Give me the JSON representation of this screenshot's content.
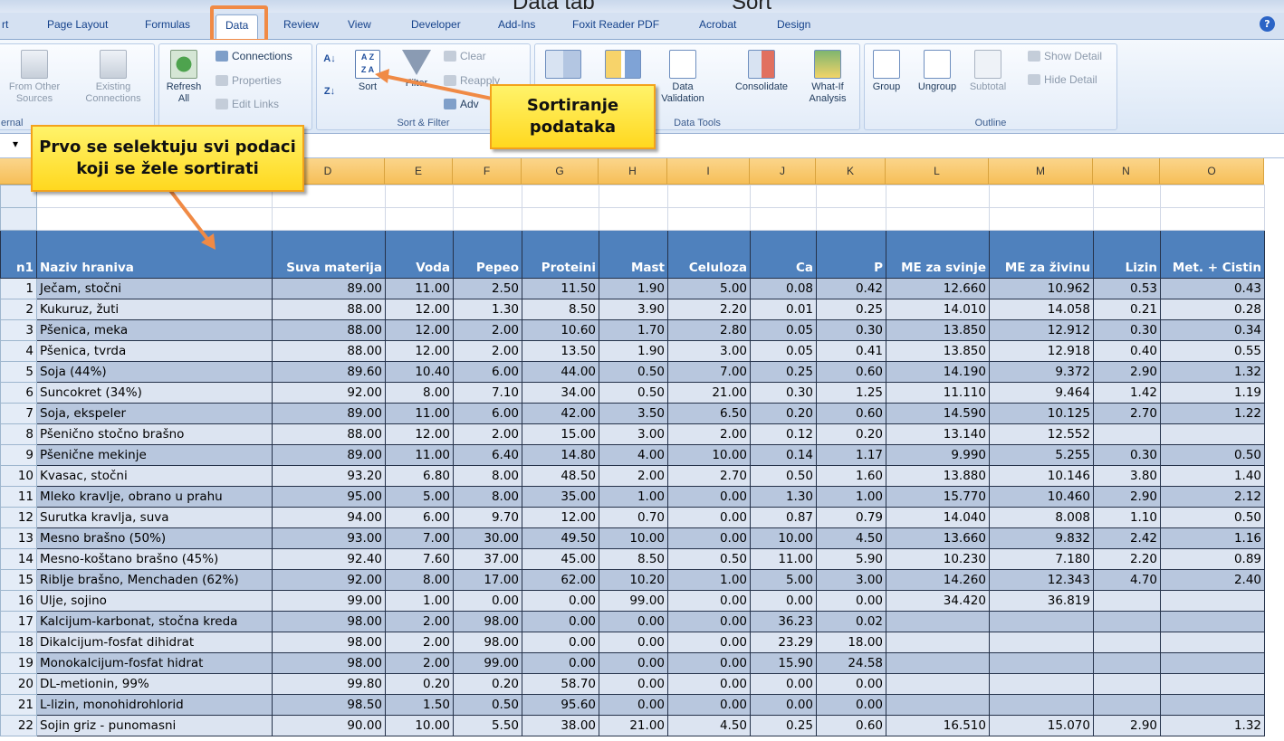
{
  "title_fragments": [
    "Data tab",
    "Sort"
  ],
  "tabs": [
    "rt",
    "Page Layout",
    "Formulas",
    "Data",
    "Review",
    "View",
    "Developer",
    "Add-Ins",
    "Foxit Reader PDF",
    "Acrobat",
    "Design"
  ],
  "ribbon": {
    "from_other_sources": "From Other Sources",
    "existing_connections": "Existing Connections",
    "refresh_all": "Refresh All",
    "connections": "Connections",
    "properties": "Properties",
    "edit_links": "Edit Links",
    "external_label": "ernal",
    "sort": "Sort",
    "filter": "Filter",
    "clear": "Clear",
    "reapply": "Reapply",
    "advanced": "Adv",
    "sort_filter_label": "Sort & Filter",
    "data_validation": "Data Validation",
    "consolidate": "Consolidate",
    "what_if": "What-If Analysis",
    "data_tools_label": "Data Tools",
    "group": "Group",
    "ungroup": "Ungroup",
    "subtotal": "Subtotal",
    "show_detail": "Show Detail",
    "hide_detail": "Hide Detail",
    "outline_label": "Outline"
  },
  "callouts": {
    "sort": "Sortiranje podataka",
    "select": "Prvo se selektuju svi podaci koji se žele sortirati"
  },
  "columns": [
    "D",
    "E",
    "F",
    "G",
    "H",
    "I",
    "J",
    "K",
    "L",
    "M",
    "N",
    "O"
  ],
  "headers": [
    "n1",
    "Naziv hraniva",
    "Suva materija",
    "Voda",
    "Pepeo",
    "Proteini",
    "Mast",
    "Celuloza",
    "Ca",
    "P",
    "ME za svinje",
    "ME za živinu",
    "Lizin",
    "Met. + Cistin"
  ],
  "rows": [
    [
      "1",
      "Ječam, stočni",
      "89.00",
      "11.00",
      "2.50",
      "11.50",
      "1.90",
      "5.00",
      "0.08",
      "0.42",
      "12.660",
      "10.962",
      "0.53",
      "0.43"
    ],
    [
      "2",
      "Kukuruz, žuti",
      "88.00",
      "12.00",
      "1.30",
      "8.50",
      "3.90",
      "2.20",
      "0.01",
      "0.25",
      "14.010",
      "14.058",
      "0.21",
      "0.28"
    ],
    [
      "3",
      "Pšenica, meka",
      "88.00",
      "12.00",
      "2.00",
      "10.60",
      "1.70",
      "2.80",
      "0.05",
      "0.30",
      "13.850",
      "12.912",
      "0.30",
      "0.34"
    ],
    [
      "4",
      "Pšenica, tvrda",
      "88.00",
      "12.00",
      "2.00",
      "13.50",
      "1.90",
      "3.00",
      "0.05",
      "0.41",
      "13.850",
      "12.918",
      "0.40",
      "0.55"
    ],
    [
      "5",
      "Soja (44%)",
      "89.60",
      "10.40",
      "6.00",
      "44.00",
      "0.50",
      "7.00",
      "0.25",
      "0.60",
      "14.190",
      "9.372",
      "2.90",
      "1.32"
    ],
    [
      "6",
      "Suncokret (34%)",
      "92.00",
      "8.00",
      "7.10",
      "34.00",
      "0.50",
      "21.00",
      "0.30",
      "1.25",
      "11.110",
      "9.464",
      "1.42",
      "1.19"
    ],
    [
      "7",
      "Soja, ekspeler",
      "89.00",
      "11.00",
      "6.00",
      "42.00",
      "3.50",
      "6.50",
      "0.20",
      "0.60",
      "14.590",
      "10.125",
      "2.70",
      "1.22"
    ],
    [
      "8",
      "Pšenično stočno brašno",
      "88.00",
      "12.00",
      "2.00",
      "15.00",
      "3.00",
      "2.00",
      "0.12",
      "0.20",
      "13.140",
      "12.552",
      "",
      ""
    ],
    [
      "9",
      "Pšenične mekinje",
      "89.00",
      "11.00",
      "6.40",
      "14.80",
      "4.00",
      "10.00",
      "0.14",
      "1.17",
      "9.990",
      "5.255",
      "0.30",
      "0.50"
    ],
    [
      "10",
      "Kvasac, stočni",
      "93.20",
      "6.80",
      "8.00",
      "48.50",
      "2.00",
      "2.70",
      "0.50",
      "1.60",
      "13.880",
      "10.146",
      "3.80",
      "1.40"
    ],
    [
      "11",
      "Mleko kravlje, obrano u prahu",
      "95.00",
      "5.00",
      "8.00",
      "35.00",
      "1.00",
      "0.00",
      "1.30",
      "1.00",
      "15.770",
      "10.460",
      "2.90",
      "2.12"
    ],
    [
      "12",
      "Surutka kravlja, suva",
      "94.00",
      "6.00",
      "9.70",
      "12.00",
      "0.70",
      "0.00",
      "0.87",
      "0.79",
      "14.040",
      "8.008",
      "1.10",
      "0.50"
    ],
    [
      "13",
      "Mesno brašno (50%)",
      "93.00",
      "7.00",
      "30.00",
      "49.50",
      "10.00",
      "0.00",
      "10.00",
      "4.50",
      "13.660",
      "9.832",
      "2.42",
      "1.16"
    ],
    [
      "14",
      "Mesno-koštano brašno (45%)",
      "92.40",
      "7.60",
      "37.00",
      "45.00",
      "8.50",
      "0.50",
      "11.00",
      "5.90",
      "10.230",
      "7.180",
      "2.20",
      "0.89"
    ],
    [
      "15",
      "Riblje brašno, Menchaden (62%)",
      "92.00",
      "8.00",
      "17.00",
      "62.00",
      "10.20",
      "1.00",
      "5.00",
      "3.00",
      "14.260",
      "12.343",
      "4.70",
      "2.40"
    ],
    [
      "16",
      "Ulje, sojino",
      "99.00",
      "1.00",
      "0.00",
      "0.00",
      "99.00",
      "0.00",
      "0.00",
      "0.00",
      "34.420",
      "36.819",
      "",
      ""
    ],
    [
      "17",
      "Kalcijum-karbonat, stočna kreda",
      "98.00",
      "2.00",
      "98.00",
      "0.00",
      "0.00",
      "0.00",
      "36.23",
      "0.02",
      "",
      "",
      "",
      ""
    ],
    [
      "18",
      "Dikalcijum-fosfat dihidrat",
      "98.00",
      "2.00",
      "98.00",
      "0.00",
      "0.00",
      "0.00",
      "23.29",
      "18.00",
      "",
      "",
      "",
      ""
    ],
    [
      "19",
      "Monokalcijum-fosfat hidrat",
      "98.00",
      "2.00",
      "99.00",
      "0.00",
      "0.00",
      "0.00",
      "15.90",
      "24.58",
      "",
      "",
      "",
      ""
    ],
    [
      "20",
      "DL-metionin, 99%",
      "99.80",
      "0.20",
      "0.20",
      "58.70",
      "0.00",
      "0.00",
      "0.00",
      "0.00",
      "",
      "",
      "",
      ""
    ],
    [
      "21",
      "L-lizin, monohidrohlorid",
      "98.50",
      "1.50",
      "0.50",
      "95.60",
      "0.00",
      "0.00",
      "0.00",
      "0.00",
      "",
      "",
      "",
      ""
    ],
    [
      "22",
      "Sojin griz - punomasni",
      "90.00",
      "10.00",
      "5.50",
      "38.00",
      "21.00",
      "4.50",
      "0.25",
      "0.60",
      "16.510",
      "15.070",
      "2.90",
      "1.32"
    ]
  ]
}
